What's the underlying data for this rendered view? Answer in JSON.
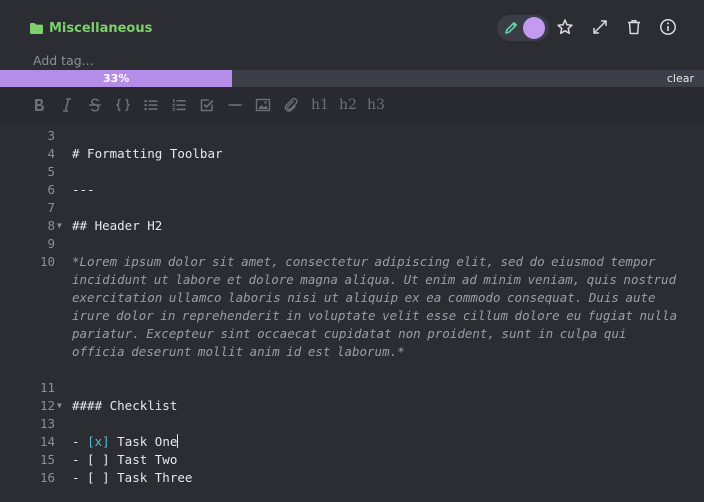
{
  "header": {
    "folder_name": "Miscellaneous",
    "folder_icon": "folder-icon",
    "folder_color": "#7ed06b",
    "edit_mode_icon": "pencil-icon",
    "toggle_color": "#c49af0",
    "actions": [
      "star-icon",
      "expand-icon",
      "trash-icon",
      "info-icon"
    ]
  },
  "tags": {
    "placeholder": "Add tag..."
  },
  "progress": {
    "value": 0.33,
    "label": "33%",
    "clear_label": "clear",
    "fill_color": "#b58ce8"
  },
  "toolbar": {
    "buttons": [
      "bold-icon",
      "italic-icon",
      "strikethrough-icon",
      "code-icon",
      "bulleted-list-icon",
      "numbered-list-icon",
      "checklist-icon",
      "horizontal-rule-icon",
      "image-icon",
      "attachment-icon"
    ],
    "h1": "h1",
    "h2": "h2",
    "h3": "h3"
  },
  "editor": {
    "lines": [
      {
        "num": "3",
        "text": ""
      },
      {
        "num": "4",
        "text": "# Formatting Toolbar"
      },
      {
        "num": "5",
        "text": ""
      },
      {
        "num": "6",
        "text": "---"
      },
      {
        "num": "7",
        "text": ""
      },
      {
        "num": "8",
        "text": "## Header H2",
        "fold": "▼"
      },
      {
        "num": "9",
        "text": ""
      },
      {
        "num": "10",
        "text": "*Lorem ipsum dolor sit amet, consectetur adipiscing elit, sed do eiusmod tempor incididunt ut labore et dolore magna aliqua. Ut enim ad minim veniam, quis nostrud exercitation ullamco laboris nisi ut aliquip ex ea commodo consequat. Duis aute irure dolor in reprehenderit in voluptate velit esse cillum dolore eu fugiat nulla pariatur. Excepteur sint occaecat cupidatat non proident, sunt in culpa qui officia deserunt mollit anim id est laborum.*"
      },
      {
        "num": "11",
        "text": ""
      },
      {
        "num": "12",
        "text": "#### Checklist",
        "fold": "▼"
      },
      {
        "num": "13",
        "text": ""
      },
      {
        "num": "14",
        "prefix": "- ",
        "box": "[x]",
        "label": " Task One"
      },
      {
        "num": "15",
        "text": "- [ ] Tast Two"
      },
      {
        "num": "16",
        "text": "- [ ] Task Three"
      }
    ]
  }
}
